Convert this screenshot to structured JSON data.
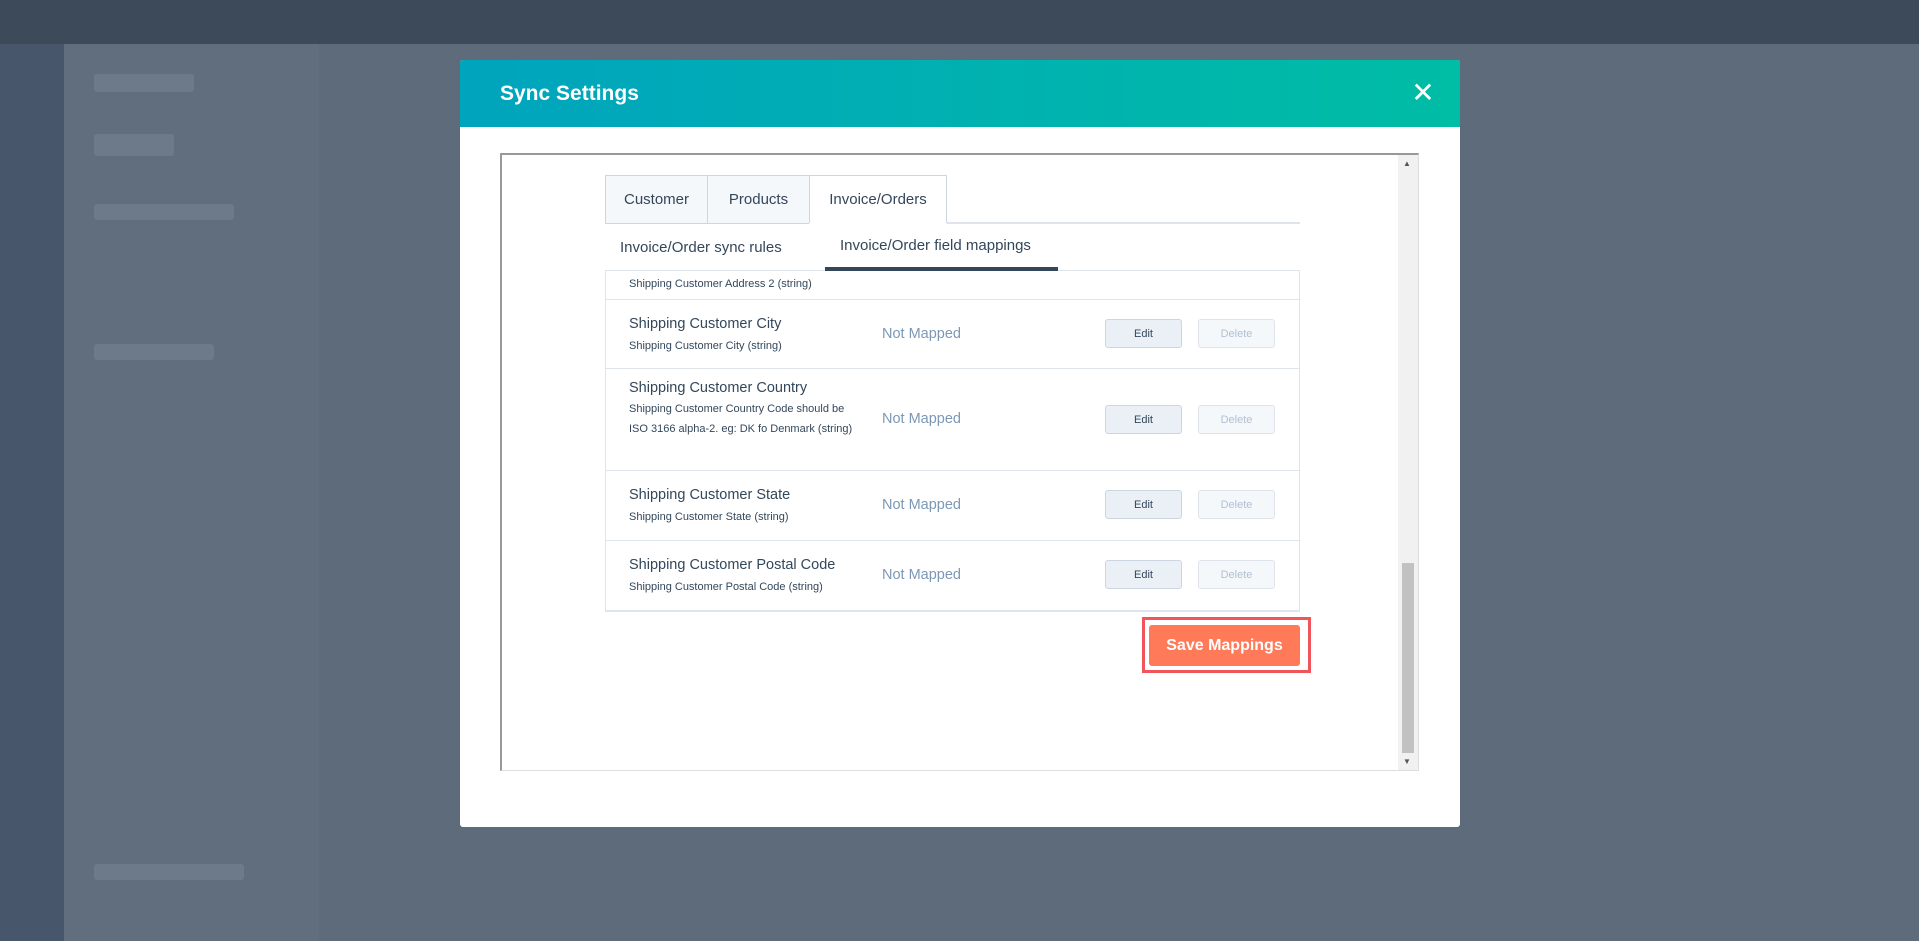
{
  "modal": {
    "title": "Sync Settings",
    "close_icon": "close-icon"
  },
  "tabs": [
    {
      "label": "Customer"
    },
    {
      "label": "Products"
    },
    {
      "label": "Invoice/Orders",
      "active": true
    }
  ],
  "subtabs": [
    {
      "label": "Invoice/Order sync rules"
    },
    {
      "label": "Invoice/Order field mappings",
      "active": true
    }
  ],
  "rows": [
    {
      "name": "",
      "desc": "Shipping Customer Address 2 (string)",
      "status": "",
      "edit": "",
      "delete": ""
    },
    {
      "name": "Shipping Customer City",
      "desc": "Shipping Customer City (string)",
      "status": "Not Mapped",
      "edit": "Edit",
      "delete": "Delete"
    },
    {
      "name": "Shipping Customer Country",
      "desc": "Shipping Customer Country Code should be ISO 3166 alpha-2. eg: DK fo Denmark (string)",
      "status": "Not Mapped",
      "edit": "Edit",
      "delete": "Delete"
    },
    {
      "name": "Shipping Customer State",
      "desc": "Shipping Customer State (string)",
      "status": "Not Mapped",
      "edit": "Edit",
      "delete": "Delete"
    },
    {
      "name": "Shipping Customer Postal Code",
      "desc": "Shipping Customer Postal Code (string)",
      "status": "Not Mapped",
      "edit": "Edit",
      "delete": "Delete"
    }
  ],
  "save_label": "Save Mappings",
  "colors": {
    "header_start": "#00a4bd",
    "header_end": "#00bda5",
    "save": "#ff7a59",
    "highlight": "#f2545b"
  }
}
